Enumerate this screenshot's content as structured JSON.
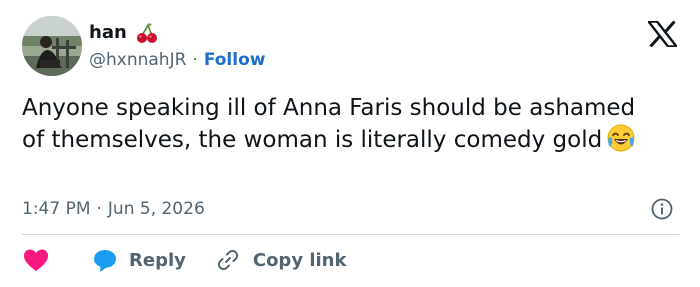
{
  "author": {
    "name": "han",
    "name_emoji": "cherries-emoji",
    "handle": "@hxnnahJR",
    "separator": "·",
    "follow_label": "Follow"
  },
  "brand": {
    "logo": "x-logo"
  },
  "tweet": {
    "text": "Anyone speaking ill of Anna Faris should be ashamed of themselves, the woman is literally comedy gold",
    "emoji": "face-with-tears-of-joy-emoji"
  },
  "meta": {
    "time": "1:47 PM",
    "separator": "·",
    "date": "Jun 5, 2026"
  },
  "actions": {
    "like_icon": "heart-icon",
    "reply_label": "Reply",
    "copy_link_label": "Copy link"
  },
  "colors": {
    "accent": "#1d70c7",
    "heart": "#f91880",
    "reply_bubble": "#1d9bf0",
    "muted": "#536471",
    "text": "#0f1419"
  }
}
